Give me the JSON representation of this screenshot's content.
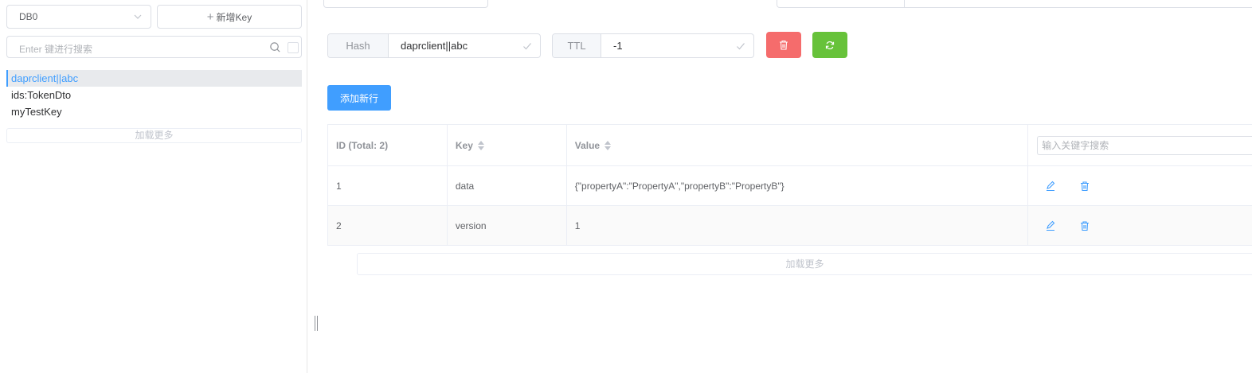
{
  "sidebar": {
    "db_select": {
      "value": "DB0"
    },
    "new_key_button": {
      "icon": "plus-icon",
      "label": "新增Key"
    },
    "search": {
      "placeholder": "Enter 键进行搜索"
    },
    "keys": [
      {
        "name": "daprclient||abc",
        "active": true
      },
      {
        "name": "ids:TokenDto",
        "active": false
      },
      {
        "name": "myTestKey",
        "active": false
      }
    ],
    "load_more": "加载更多"
  },
  "detail": {
    "type_label": "Hash",
    "key_name": "daprclient||abc",
    "ttl_label": "TTL",
    "ttl_value": "-1",
    "delete_button_icon": "trash-icon",
    "refresh_button_icon": "refresh-icon",
    "add_row_button": "添加新行",
    "table": {
      "headers": {
        "id": "ID (Total: 2)",
        "key": "Key",
        "value": "Value"
      },
      "search_placeholder": "输入关键字搜索",
      "rows": [
        {
          "id": "1",
          "key": "data",
          "value": "{\"propertyA\":\"PropertyA\",\"propertyB\":\"PropertyB\"}"
        },
        {
          "id": "2",
          "key": "version",
          "value": "1"
        }
      ]
    },
    "load_more": "加载更多"
  },
  "colors": {
    "primary": "#409eff",
    "danger": "#f56c6c",
    "success": "#67c23a",
    "border": "#dcdfe6"
  }
}
